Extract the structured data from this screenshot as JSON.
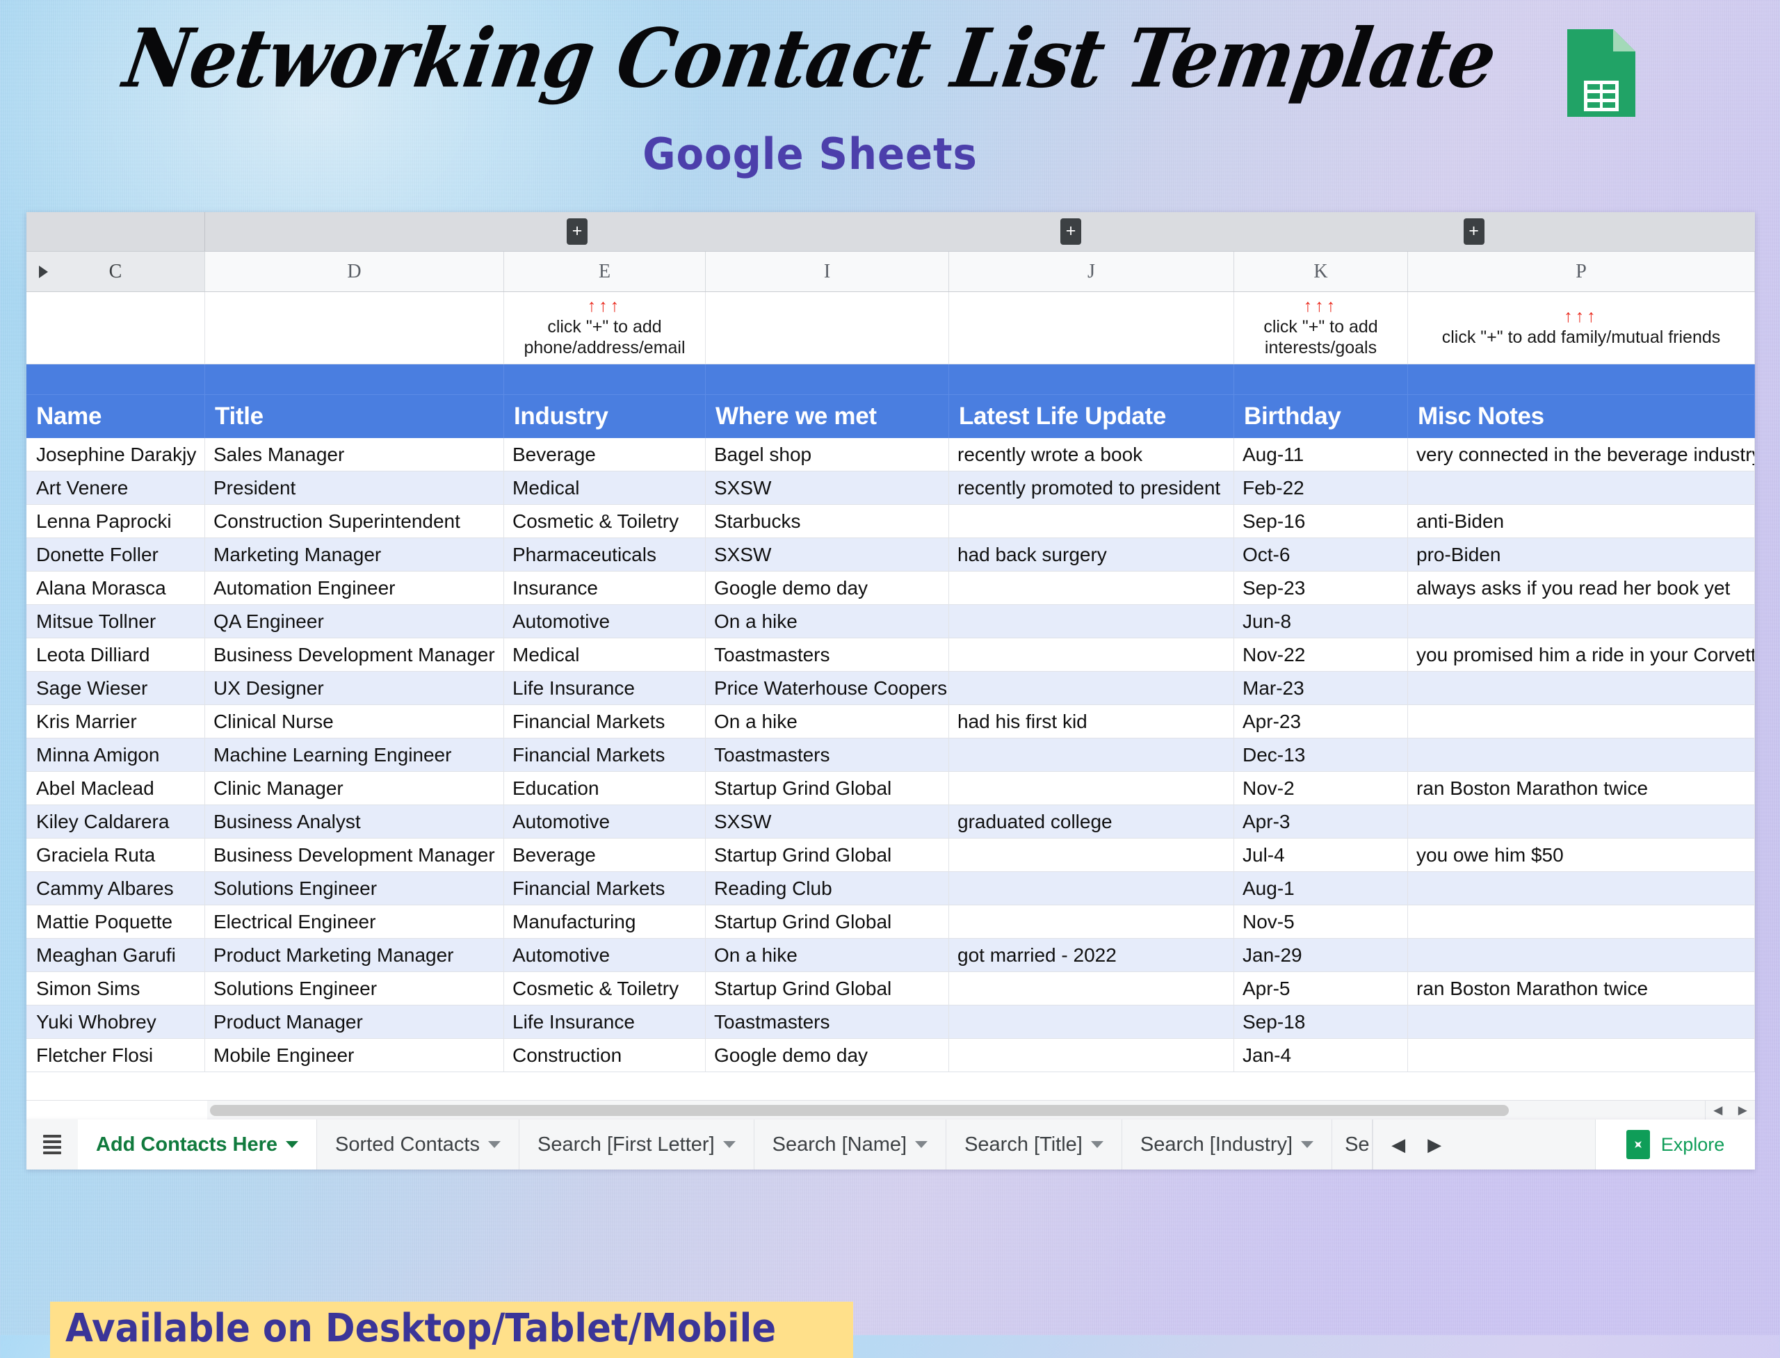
{
  "header": {
    "title": "Networking Contact List Template",
    "subtitle": "Google Sheets",
    "logo_icon": "google-sheets-icon"
  },
  "colors": {
    "header_blue": "#4a7ee0",
    "accent_purple": "#4c3fab",
    "banner_yellow": "#ffe08a",
    "banner_text": "#3b3598",
    "sheets_green": "#0f9d58",
    "arrow_red": "#ea2b1f"
  },
  "spreadsheet": {
    "column_letters": [
      "C",
      "D",
      "E",
      "I",
      "J",
      "K",
      "P"
    ],
    "group_plus_label": "+",
    "notes": {
      "arrows": "↑↑↑",
      "e": "click \"+\" to add\nphone/address/email",
      "e_line1": "click \"+\" to add",
      "e_line2": "phone/address/email",
      "k_line1": "click \"+\" to add",
      "k_line2": "interests/goals",
      "p_line1": "click \"+\" to add family/mutual friends"
    },
    "headers": [
      "Name",
      "Title",
      "Industry",
      "Where we met",
      "Latest Life Update",
      "Birthday",
      "Misc Notes"
    ],
    "rows": [
      [
        "Josephine Darakjy",
        "Sales Manager",
        "Beverage",
        "Bagel shop",
        "recently wrote a book",
        "Aug-11",
        "very connected in the beverage industry"
      ],
      [
        "Art Venere",
        "President",
        "Medical",
        "SXSW",
        "recently promoted to president",
        "Feb-22",
        ""
      ],
      [
        "Lenna Paprocki",
        "Construction Superintendent",
        "Cosmetic & Toiletry",
        "Starbucks",
        "",
        "Sep-16",
        "anti-Biden"
      ],
      [
        "Donette Foller",
        "Marketing Manager",
        "Pharmaceuticals",
        "SXSW",
        "had back surgery",
        "Oct-6",
        "pro-Biden"
      ],
      [
        "Alana Morasca",
        "Automation Engineer",
        "Insurance",
        "Google demo day",
        "",
        "Sep-23",
        "always asks if you read her book yet"
      ],
      [
        "Mitsue Tollner",
        "QA Engineer",
        "Automotive",
        "On a hike",
        "",
        "Jun-8",
        ""
      ],
      [
        "Leota Dilliard",
        "Business Development Manager",
        "Medical",
        "Toastmasters",
        "",
        "Nov-22",
        "you promised him a ride in your Corvette"
      ],
      [
        "Sage Wieser",
        "UX Designer",
        "Life Insurance",
        "Price Waterhouse Coopers",
        "",
        "Mar-23",
        ""
      ],
      [
        "Kris Marrier",
        "Clinical Nurse",
        "Financial Markets",
        "On a hike",
        "had his first kid",
        "Apr-23",
        ""
      ],
      [
        "Minna Amigon",
        "Machine Learning Engineer",
        "Financial Markets",
        "Toastmasters",
        "",
        "Dec-13",
        ""
      ],
      [
        "Abel Maclead",
        "Clinic Manager",
        "Education",
        "Startup Grind Global",
        "",
        "Nov-2",
        "ran Boston Marathon twice"
      ],
      [
        "Kiley Caldarera",
        "Business Analyst",
        "Automotive",
        "SXSW",
        "graduated college",
        "Apr-3",
        ""
      ],
      [
        "Graciela Ruta",
        "Business Development Manager",
        "Beverage",
        "Startup Grind Global",
        "",
        "Jul-4",
        "you owe him $50"
      ],
      [
        "Cammy Albares",
        "Solutions Engineer",
        "Financial Markets",
        "Reading Club",
        "",
        "Aug-1",
        ""
      ],
      [
        "Mattie Poquette",
        "Electrical Engineer",
        "Manufacturing",
        "Startup Grind Global",
        "",
        "Nov-5",
        ""
      ],
      [
        "Meaghan Garufi",
        "Product Marketing Manager",
        "Automotive",
        "On a hike",
        "got married - 2022",
        "Jan-29",
        ""
      ],
      [
        "Simon Sims",
        "Solutions Engineer",
        "Cosmetic & Toiletry",
        "Startup Grind Global",
        "",
        "Apr-5",
        "ran Boston Marathon twice"
      ],
      [
        "Yuki Whobrey",
        "Product Manager",
        "Life Insurance",
        "Toastmasters",
        "",
        "Sep-18",
        ""
      ],
      [
        "Fletcher Flosi",
        "Mobile Engineer",
        "Construction",
        "Google demo day",
        "",
        "Jan-4",
        ""
      ]
    ]
  },
  "tabbar": {
    "menu_icon": "all-sheets-icon",
    "tabs": [
      {
        "label": "Add Contacts Here",
        "active": true
      },
      {
        "label": "Sorted Contacts",
        "active": false
      },
      {
        "label": "Search [First Letter]",
        "active": false
      },
      {
        "label": "Search [Name]",
        "active": false
      },
      {
        "label": "Search [Title]",
        "active": false
      },
      {
        "label": "Search [Industry]",
        "active": false
      },
      {
        "label": "Se",
        "active": false
      }
    ],
    "nav_prev": "◀",
    "nav_next": "▶",
    "explore_label": "Explore"
  },
  "footer": {
    "banner_text": "Available on Desktop/Tablet/Mobile"
  }
}
